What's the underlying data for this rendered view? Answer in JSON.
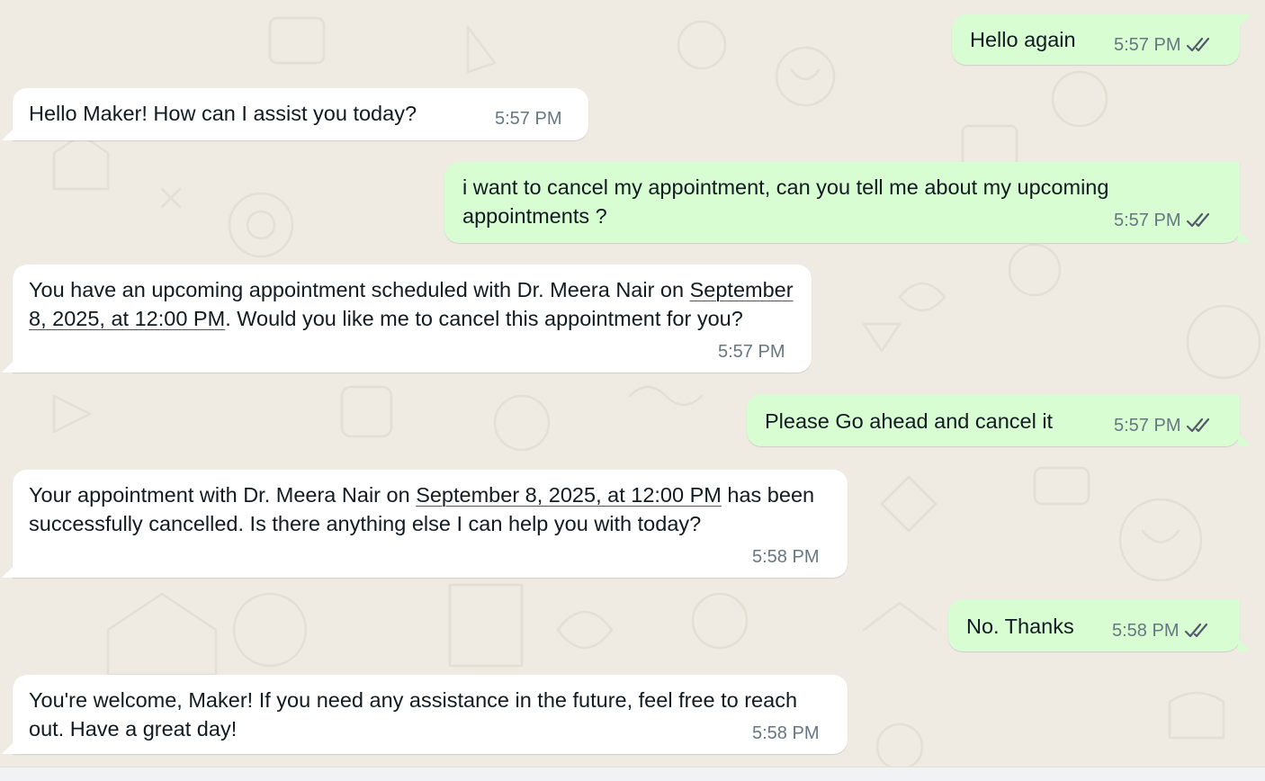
{
  "colors": {
    "background": "#efeae2",
    "incoming_bubble": "#ffffff",
    "outgoing_bubble": "#d9fdd3",
    "timestamp": "#667781",
    "read_ticks": "#53596b"
  },
  "messages": [
    {
      "direction": "outgoing",
      "text": "Hello again",
      "time": "5:57 PM",
      "status_icon": "double-check-icon"
    },
    {
      "direction": "incoming",
      "text": "Hello Maker! How can I assist you today?",
      "time": "5:57 PM"
    },
    {
      "direction": "outgoing",
      "text": "i want to cancel my appointment, can you tell me about my upcoming appointments ?",
      "time": "5:57 PM",
      "status_icon": "double-check-icon"
    },
    {
      "direction": "incoming",
      "text_before": "You have an upcoming appointment scheduled with Dr. Meera Nair on ",
      "link": "September 8, 2025, at 12:00 PM",
      "text_after": ". Would you like me to cancel this appointment for you?",
      "time": "5:57 PM"
    },
    {
      "direction": "outgoing",
      "text": "Please Go ahead and cancel it",
      "time": "5:57 PM",
      "status_icon": "double-check-icon"
    },
    {
      "direction": "incoming",
      "text_before": "Your appointment with Dr. Meera Nair on ",
      "link": "September 8, 2025, at 12:00 PM",
      "text_after": " has been successfully cancelled. Is there anything else I can help you with today?",
      "time": "5:58 PM"
    },
    {
      "direction": "outgoing",
      "text": "No. Thanks",
      "time": "5:58 PM",
      "status_icon": "double-check-icon"
    },
    {
      "direction": "incoming",
      "text": "You're welcome, Maker! If you need any assistance in the future, feel free to reach out. Have a great day!",
      "time": "5:58 PM"
    }
  ]
}
